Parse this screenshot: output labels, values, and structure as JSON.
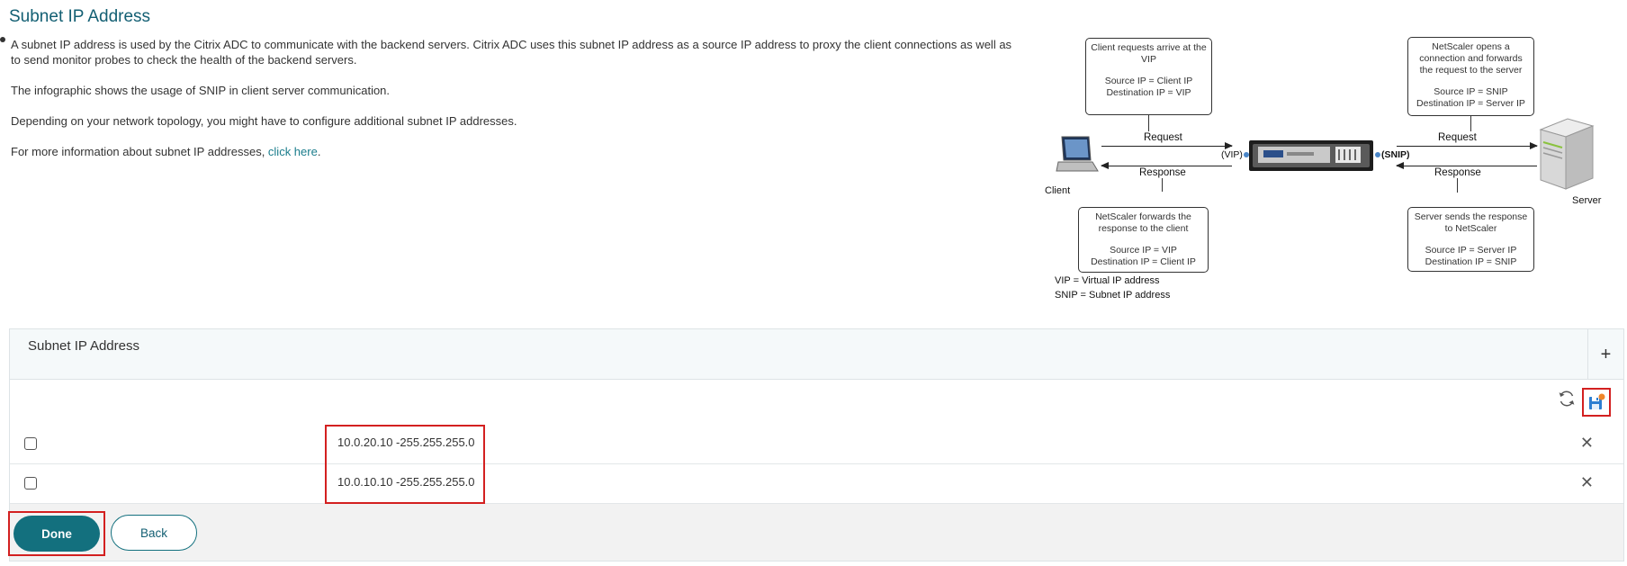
{
  "page": {
    "title": "Subnet IP Address",
    "paragraphs": [
      "A subnet IP address is used by the Citrix ADC to communicate with the backend servers. Citrix ADC uses this subnet IP address as a source IP address to proxy the client connections as well as to send monitor probes to check the health of the backend servers.",
      "The infographic shows the usage of SNIP in client server communication.",
      "Depending on your network topology, you might have to configure additional subnet IP addresses."
    ],
    "more_info_prefix": "For more information about subnet IP addresses, ",
    "more_info_link": "click here",
    "more_info_suffix": "."
  },
  "infographic": {
    "box_client_request": [
      "Client requests arrive at the",
      "VIP",
      "",
      "Source IP = Client IP",
      "Destination IP = VIP"
    ],
    "box_netscaler_opens": [
      "NetScaler opens a",
      "connection and forwards",
      "the request to the server",
      "",
      "Source IP = SNIP",
      "Destination IP = Server IP"
    ],
    "box_netscaler_forwards": [
      "NetScaler forwards the",
      "response to the client",
      "",
      "Source IP = VIP",
      "Destination IP = Client IP"
    ],
    "box_server_sends": [
      "Server sends the response",
      "to NetScaler",
      "",
      "Source IP = Server IP",
      "Destination IP = SNIP"
    ],
    "request_label": "Request",
    "response_label": "Response",
    "vip_label": "(VIP)",
    "snip_label": "(SNIP)",
    "client_label": "Client",
    "server_label": "Server",
    "legend_vip": "VIP = Virtual IP address",
    "legend_snip": "SNIP = Subnet IP address"
  },
  "panel": {
    "title": "Subnet IP Address",
    "add_symbol": "+",
    "rows": [
      {
        "value": "10.0.20.10 -255.255.255.0"
      },
      {
        "value": "10.0.10.10 -255.255.255.0"
      }
    ],
    "delete_symbol": "✕"
  },
  "buttons": {
    "done": "Done",
    "back": "Back"
  },
  "colors": {
    "accent": "#13707e",
    "title": "#135f73",
    "highlight": "#d32020",
    "link": "#1b7d8c"
  },
  "icons": {
    "refresh": "refresh-icon",
    "save": "save-icon",
    "client": "laptop-icon",
    "server": "server-icon",
    "appliance": "netscaler-appliance-icon"
  }
}
